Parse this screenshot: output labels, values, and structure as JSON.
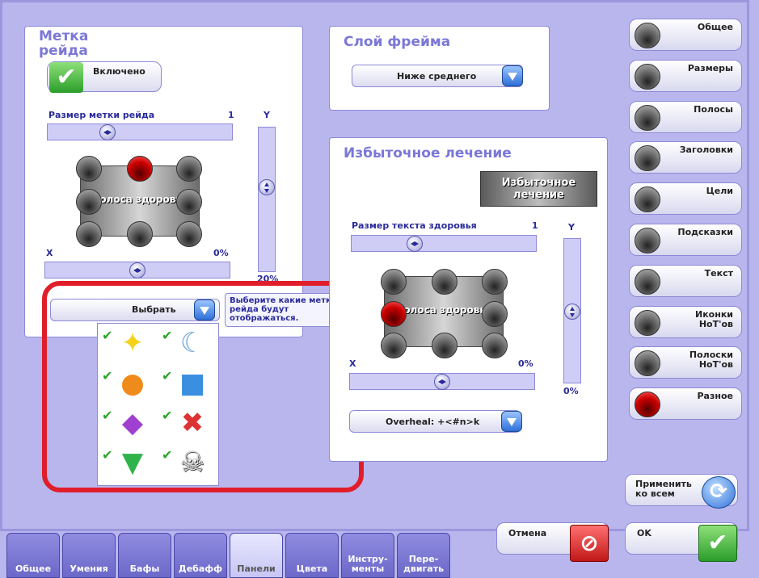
{
  "raid_mark": {
    "title": "Метка рейда",
    "enabled_label": "Включено",
    "size_label": "Размер метки рейда",
    "size_value": "1",
    "y_label": "Y",
    "y_value": "20%",
    "x_label": "X",
    "x_value": "0%",
    "preview_text": "Полоса здоровья",
    "select_label": "Выбрать",
    "tooltip": "Выберите какие метки рейда будут отображаться."
  },
  "frame_layer": {
    "title": "Слой фрейма",
    "dropdown_value": "Ниже среднего"
  },
  "overheal": {
    "title": "Избыточное лечение",
    "preview_badge": "Избыточное лечение",
    "text_size_label": "Размер текста здоровья",
    "text_size_value": "1",
    "y_label": "Y",
    "y_value": "0%",
    "x_label": "X",
    "x_value": "0%",
    "preview_text": "Полоса здоровья",
    "format_value": "Overheal: +<#n>k"
  },
  "raid_icons": [
    {
      "name": "star-icon",
      "glyph": "✦",
      "color": "#f5d21a",
      "checked": true
    },
    {
      "name": "moon-icon",
      "glyph": "☾",
      "color": "#6fa8dc",
      "checked": true
    },
    {
      "name": "circle-icon",
      "glyph": "●",
      "color": "#ef8b1a",
      "checked": true
    },
    {
      "name": "square-icon",
      "glyph": "■",
      "color": "#3a8fe0",
      "checked": true
    },
    {
      "name": "diamond-icon",
      "glyph": "◆",
      "color": "#a040d0",
      "checked": true
    },
    {
      "name": "cross-icon",
      "glyph": "✖",
      "color": "#d33",
      "checked": true
    },
    {
      "name": "triangle-icon",
      "glyph": "▼",
      "color": "#2db34a",
      "checked": true
    },
    {
      "name": "skull-icon",
      "glyph": "☠",
      "color": "#f0f0f0",
      "checked": true
    }
  ],
  "side_menu": [
    {
      "label": "Общее",
      "active": false
    },
    {
      "label": "Размеры",
      "active": false
    },
    {
      "label": "Полосы",
      "active": false
    },
    {
      "label": "Заголовки",
      "active": false
    },
    {
      "label": "Цели",
      "active": false
    },
    {
      "label": "Подсказки",
      "active": false
    },
    {
      "label": "Текст",
      "active": false
    },
    {
      "label": "Иконки НоТ'ов",
      "active": false
    },
    {
      "label": "Полоски НоТ'ов",
      "active": false
    },
    {
      "label": "Разное",
      "active": true
    }
  ],
  "actions": {
    "apply_all": "Применить ко всем",
    "cancel": "Отмена",
    "ok": "OK"
  },
  "tabs": [
    {
      "label": "Общее",
      "active": false
    },
    {
      "label": "Умения",
      "active": false
    },
    {
      "label": "Бафы",
      "active": false
    },
    {
      "label": "Дебафф",
      "active": false
    },
    {
      "label": "Панели",
      "active": true
    },
    {
      "label": "Цвета",
      "active": false
    },
    {
      "label": "Инстру-менты",
      "active": false
    },
    {
      "label": "Пере-двигать",
      "active": false
    }
  ],
  "colors": {
    "accent": "#7b78d8",
    "highlight_box": "#e01e2a"
  }
}
